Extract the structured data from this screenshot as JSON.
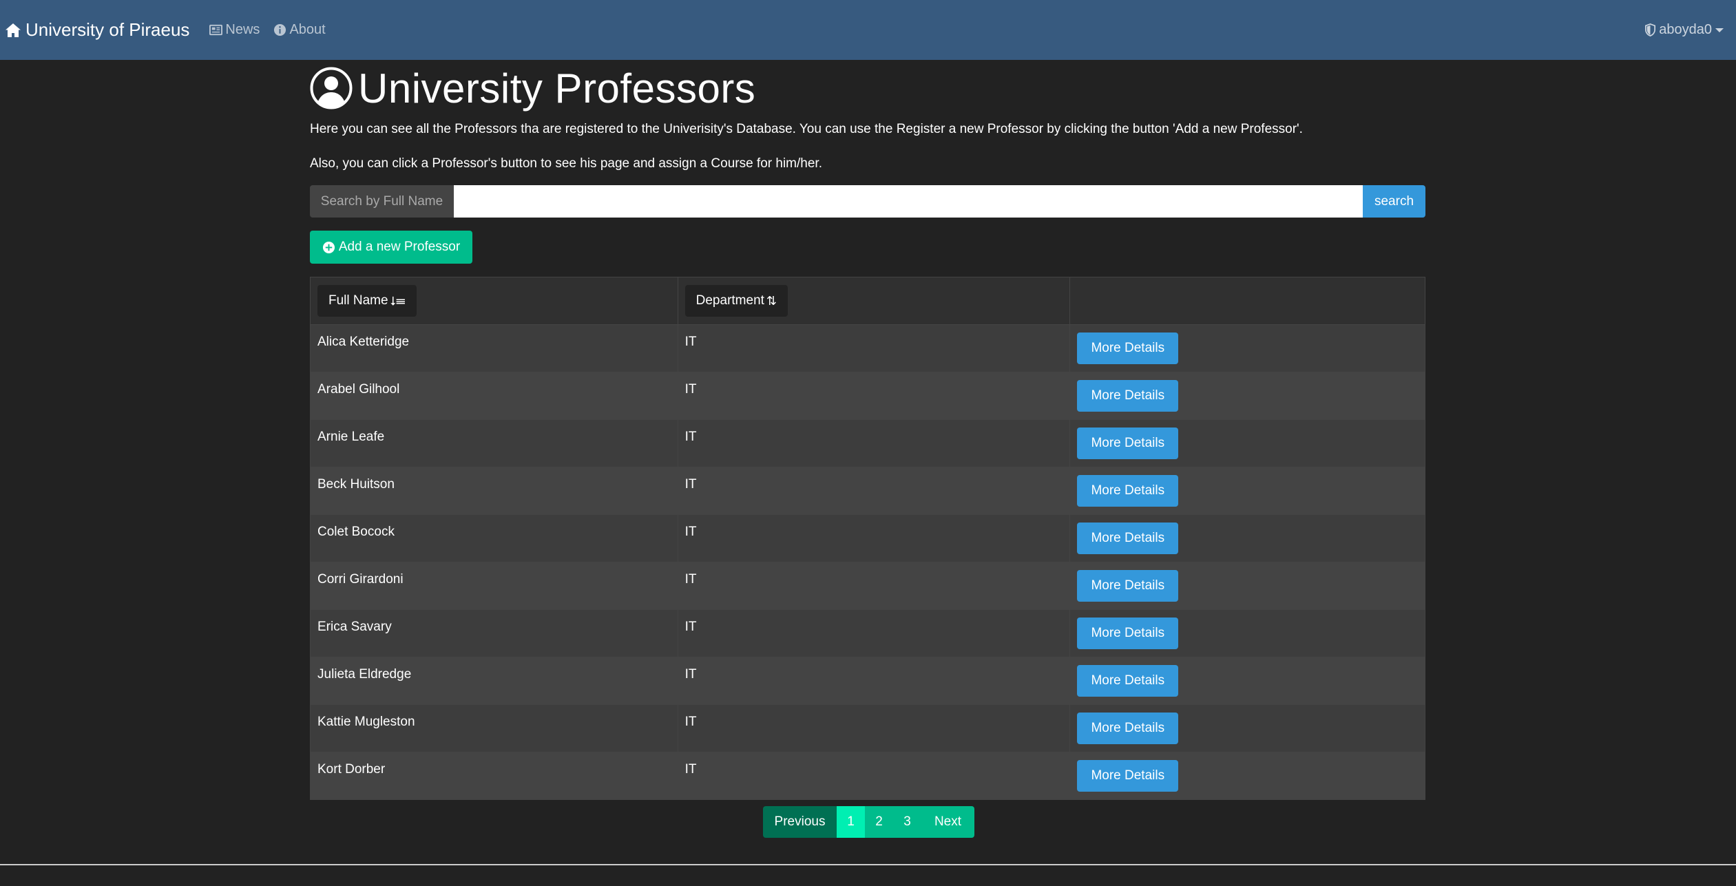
{
  "navbar": {
    "brand": "University of Piraeus",
    "links": [
      {
        "label": "News",
        "icon": "newspaper-icon"
      },
      {
        "label": "About",
        "icon": "info-icon"
      }
    ],
    "user": "aboyda0"
  },
  "page": {
    "title": "University Professors",
    "desc1": "Here you can see all the Professors tha are registered to the Univerisity's Database. You can use the Register a new Professor by clicking the button 'Add a new Professor'.",
    "desc2": "Also, you can click a Professor's button to see his page and assign a Course for him/her."
  },
  "search": {
    "label": "Search by Full Name",
    "value": "",
    "placeholder": "",
    "button": "search"
  },
  "add_button": "Add a new Professor",
  "table": {
    "headers": {
      "full_name": "Full Name",
      "department": "Department"
    },
    "sort_glyphs": {
      "full_name": "⭣☰",
      "department": "⇅"
    },
    "rows": [
      {
        "name": "Alica Ketteridge",
        "dept": "IT",
        "action": "More Details"
      },
      {
        "name": "Arabel Gilhool",
        "dept": "IT",
        "action": "More Details"
      },
      {
        "name": "Arnie Leafe",
        "dept": "IT",
        "action": "More Details"
      },
      {
        "name": "Beck Huitson",
        "dept": "IT",
        "action": "More Details"
      },
      {
        "name": "Colet Bocock",
        "dept": "IT",
        "action": "More Details"
      },
      {
        "name": "Corri Girardoni",
        "dept": "IT",
        "action": "More Details"
      },
      {
        "name": "Erica Savary",
        "dept": "IT",
        "action": "More Details"
      },
      {
        "name": "Julieta Eldredge",
        "dept": "IT",
        "action": "More Details"
      },
      {
        "name": "Kattie Mugleston",
        "dept": "IT",
        "action": "More Details"
      },
      {
        "name": "Kort Dorber",
        "dept": "IT",
        "action": "More Details"
      }
    ]
  },
  "pagination": {
    "previous": "Previous",
    "pages": [
      "1",
      "2",
      "3"
    ],
    "active": "1",
    "next": "Next"
  },
  "colors": {
    "navbar": "#375a7f",
    "background": "#222222",
    "primary": "#3498db",
    "success": "#00bc8c"
  }
}
